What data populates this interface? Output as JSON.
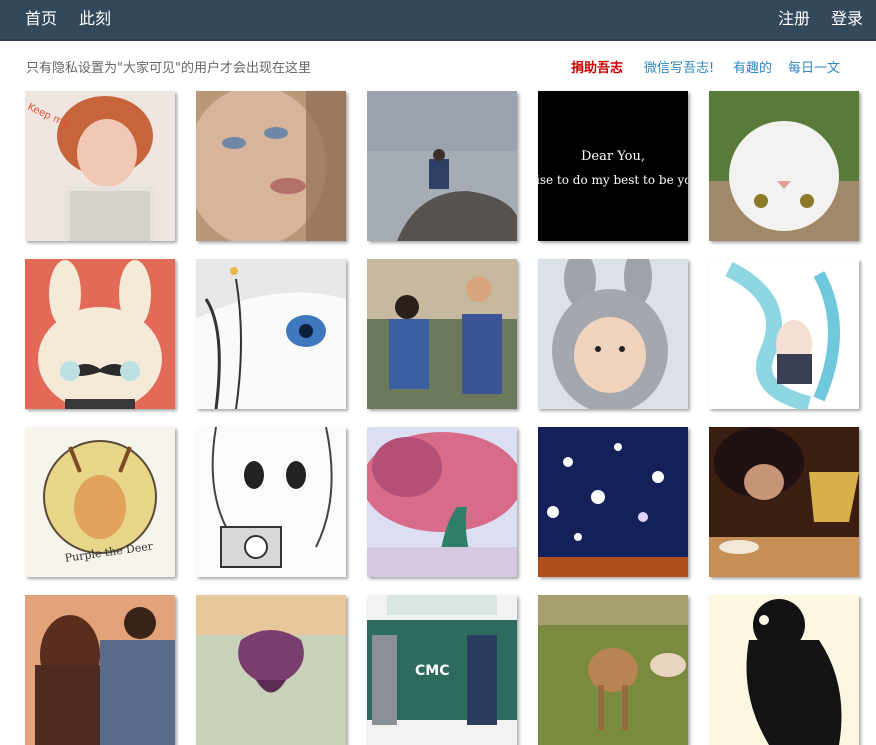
{
  "nav": {
    "home": "首页",
    "now": "此刻",
    "register": "注册",
    "login": "登录"
  },
  "subbar": {
    "notice": "只有隐私设置为\"大家可见\"的用户才会出现在这里",
    "donate": "捐助吾志",
    "wechat": "微信写吾志!",
    "fun": "有趣的",
    "daily": "每日一文"
  },
  "tiles": [
    {
      "icon": "girl-red-hair-photo",
      "text": "Keep me"
    },
    {
      "icon": "woman-face-photo"
    },
    {
      "icon": "misty-rock-photo"
    },
    {
      "icon": "dear-you-text-image",
      "text": "Dear You,",
      "text2": "ise to do my best to be you"
    },
    {
      "icon": "upside-down-cat-photo"
    },
    {
      "icon": "mustache-bunny-illustration"
    },
    {
      "icon": "anime-eye-illustration"
    },
    {
      "icon": "two-men-park-photo"
    },
    {
      "icon": "child-bunny-hood-photo"
    },
    {
      "icon": "blue-hair-anime-girl-illustration"
    },
    {
      "icon": "purple-deer-badge-illustration",
      "text": "Purple the Deer"
    },
    {
      "icon": "anime-girl-camera-illustration"
    },
    {
      "icon": "pink-tree-painting"
    },
    {
      "icon": "snowflake-night-illustration"
    },
    {
      "icon": "woman-lamp-photo"
    },
    {
      "icon": "couple-sunset-photo"
    },
    {
      "icon": "purple-flower-photo"
    },
    {
      "icon": "truck-legs-photo",
      "text": "CMC"
    },
    {
      "icon": "deer-field-photo"
    },
    {
      "icon": "bear-ink-illustration"
    }
  ]
}
